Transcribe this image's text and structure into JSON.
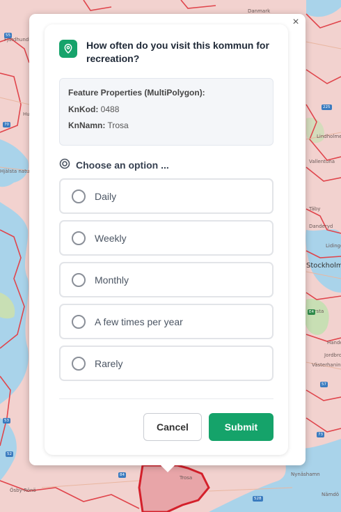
{
  "map": {
    "labels": [
      "Fjärdhundra",
      "Danmark",
      "Huddunge",
      "Hjälsta naturreservat",
      "Lindholmen",
      "Vallentuna",
      "Täby",
      "Danderyd",
      "Lidingö",
      "Stockholm",
      "Farsta",
      "Handen",
      "Jordbro",
      "Västerhaninge",
      "Nynäshamn",
      "Trosa",
      "Nämdö",
      "Ösby-Rönö"
    ],
    "road_numbers": [
      "55",
      "70",
      "53",
      "52",
      "57",
      "225",
      "73",
      "84",
      "528",
      "E4"
    ]
  },
  "popup": {
    "close_glyph": "×",
    "icon": "map-pin-icon",
    "question": "How often do you visit this kommun for recreation?",
    "properties": {
      "title": "Feature Properties (MultiPolygon):",
      "rows": [
        {
          "key": "KnKod:",
          "value": "0488"
        },
        {
          "key": "KnNamn:",
          "value": "Trosa"
        }
      ]
    },
    "choose_label": "Choose an option ...",
    "choose_icon": "target-icon",
    "options": [
      "Daily",
      "Weekly",
      "Monthly",
      "A few times per year",
      "Rarely"
    ],
    "cancel_label": "Cancel",
    "submit_label": "Submit"
  },
  "colors": {
    "accent": "#15a36a",
    "map_region": "#f2d2cf",
    "map_border": "#e0454c",
    "water": "#a9d3ea"
  }
}
